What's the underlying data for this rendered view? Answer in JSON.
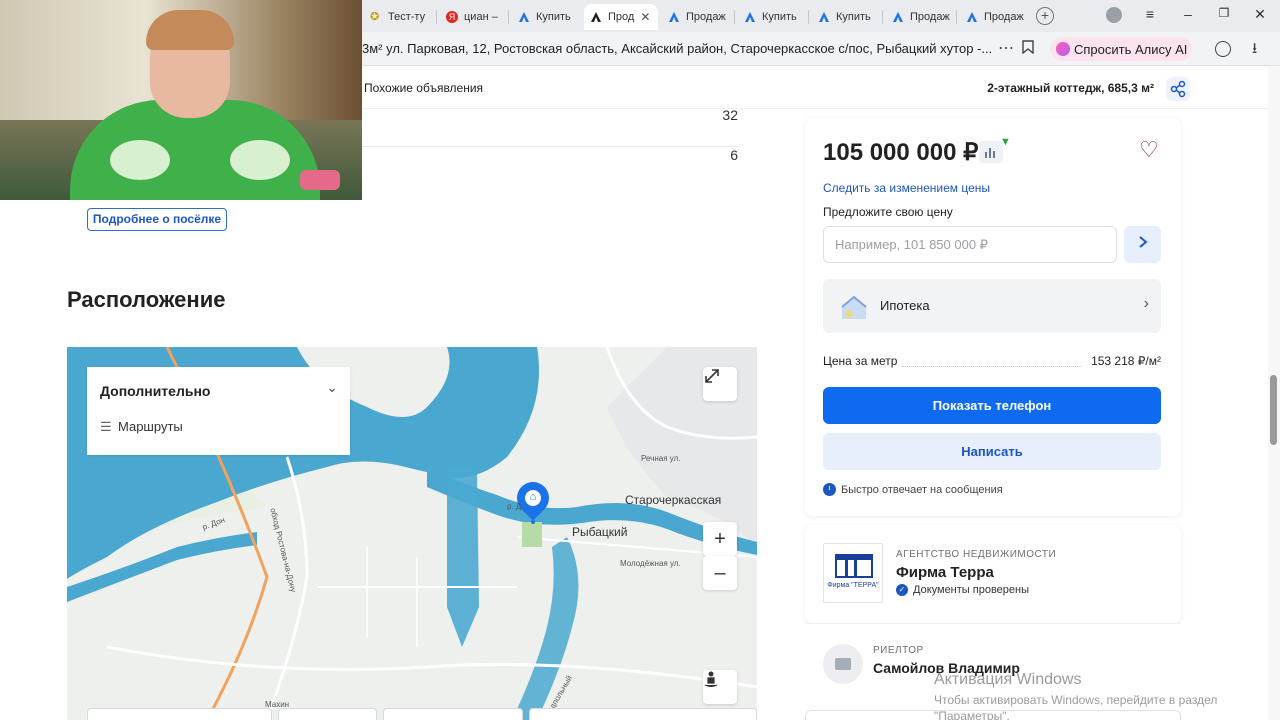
{
  "browser": {
    "tabs": [
      {
        "label": "Тест-ту",
        "icon": "star-icon",
        "active": false
      },
      {
        "label": "циан –",
        "icon": "yandex-icon",
        "active": false
      },
      {
        "label": "Купить",
        "icon": "realty-icon",
        "active": false
      },
      {
        "label": "Прод",
        "icon": "realty-icon",
        "active": true
      },
      {
        "label": "Продаж",
        "icon": "realty-icon",
        "active": false
      },
      {
        "label": "Купить",
        "icon": "realty-icon",
        "active": false
      },
      {
        "label": "Купить",
        "icon": "realty-icon",
        "active": false
      },
      {
        "label": "Продаж",
        "icon": "realty-icon",
        "active": false
      },
      {
        "label": "Продаж",
        "icon": "realty-icon",
        "active": false
      }
    ],
    "new_tab": "+",
    "url": "3м² ул. Парковая, 12, Ростовская область, Аксайский район, Старочеркасское с/пос, Рыбацкий хутор -...",
    "alice_label": "Спросить Алису AI",
    "menu_glyph": "≡",
    "minimize_glyph": "–",
    "restore_glyph": "❐",
    "close_glyph": "✕",
    "dots_glyph": "⋯",
    "bookmark_glyph": "🔖",
    "download_glyph": "⭳"
  },
  "subheader": {
    "similar_label": "Похожие объявления",
    "cottage_label": "2-этажный коттедж, 685,3 м²"
  },
  "table_rows": [
    {
      "value": "32"
    },
    {
      "value": "6"
    }
  ],
  "poselok_button": "Подробнее о посёлке",
  "location_title": "Расположение",
  "map": {
    "panel_title": "Дополнительно",
    "routes_label": "Маршруты",
    "zoom_in": "+",
    "zoom_out": "–",
    "labels": {
      "starocherkasskaya": "Старочеркасская",
      "rybatsky": "Рыбацкий",
      "rechnaya": "Речная ул.",
      "molodezhnaya": "Молодёжная ул.",
      "obhod": "обход Ростова-на-Дону",
      "don1": "р. Дон",
      "don2": "р. Д",
      "makhin": "Махин",
      "podpolnaya": "Подпольный"
    }
  },
  "price_card": {
    "price": "105 000 000 ₽",
    "follow_price": "Следить за изменением цены",
    "offer_label": "Предложите свою цену",
    "offer_placeholder": "Например, 101 850 000 ₽",
    "ipoteka": "Ипотека",
    "price_per_meter_label": "Цена за метр",
    "price_per_meter_value": "153 218 ₽/м²",
    "show_phone": "Показать телефон",
    "write": "Написать",
    "fast_reply": "Быстро отвечает на сообщения"
  },
  "agency": {
    "type": "АГЕНТСТВО НЕДВИЖИМОСТИ",
    "name": "Фирма Терра",
    "verified": "Документы проверены",
    "logo_text": "Фирма \"ТЕРРА\""
  },
  "realtor": {
    "type": "РИЕЛТОР",
    "name": "Самойлов Владимир"
  },
  "windows_activation": {
    "title": "Активация Windows",
    "line1": "Чтобы активировать Windows, перейдите в раздел",
    "line2": "\"Параметры\"."
  },
  "colors": {
    "primary_blue": "#0e6bf0",
    "link_blue": "#1d55c4",
    "heart": "#9a2143",
    "river": "#4aa8d0"
  }
}
